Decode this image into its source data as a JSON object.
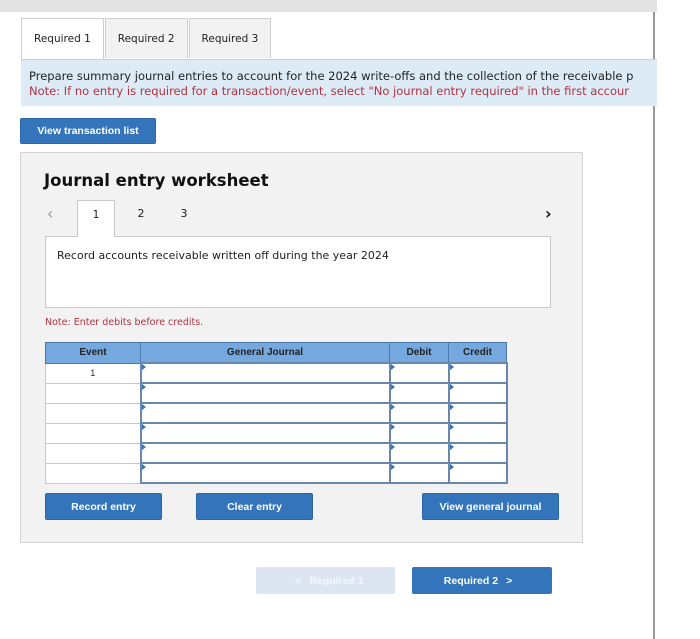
{
  "tabs": [
    {
      "label": "Required 1",
      "active": true
    },
    {
      "label": "Required 2",
      "active": false
    },
    {
      "label": "Required 3",
      "active": false
    }
  ],
  "instructions": {
    "main": "Prepare summary journal entries to account for the 2024 write-offs and the collection of the receivable p",
    "note": "Note: If no entry is required for a transaction/event, select \"No journal entry required\" in the first accour"
  },
  "buttons": {
    "view_transaction_list": "View transaction list",
    "record_entry": "Record entry",
    "clear_entry": "Clear entry",
    "view_general_journal": "View general journal"
  },
  "worksheet": {
    "title": "Journal entry worksheet",
    "prev_icon": "‹",
    "next_icon": "›",
    "steps": [
      "1",
      "2",
      "3"
    ],
    "active_step": "1",
    "description": "Record accounts receivable written off during the year 2024",
    "debit_note": "Note: Enter debits before credits."
  },
  "journal_table": {
    "headers": [
      "Event",
      "General Journal",
      "Debit",
      "Credit"
    ],
    "rows": [
      {
        "event": "1",
        "account": "",
        "debit": "",
        "credit": ""
      },
      {
        "event": "",
        "account": "",
        "debit": "",
        "credit": ""
      },
      {
        "event": "",
        "account": "",
        "debit": "",
        "credit": ""
      },
      {
        "event": "",
        "account": "",
        "debit": "",
        "credit": ""
      },
      {
        "event": "",
        "account": "",
        "debit": "",
        "credit": ""
      },
      {
        "event": "",
        "account": "",
        "debit": "",
        "credit": ""
      }
    ]
  },
  "navigation": {
    "prev_label": "Required 1",
    "prev_icon": "<",
    "prev_disabled": true,
    "next_label": "Required 2",
    "next_icon": ">"
  }
}
